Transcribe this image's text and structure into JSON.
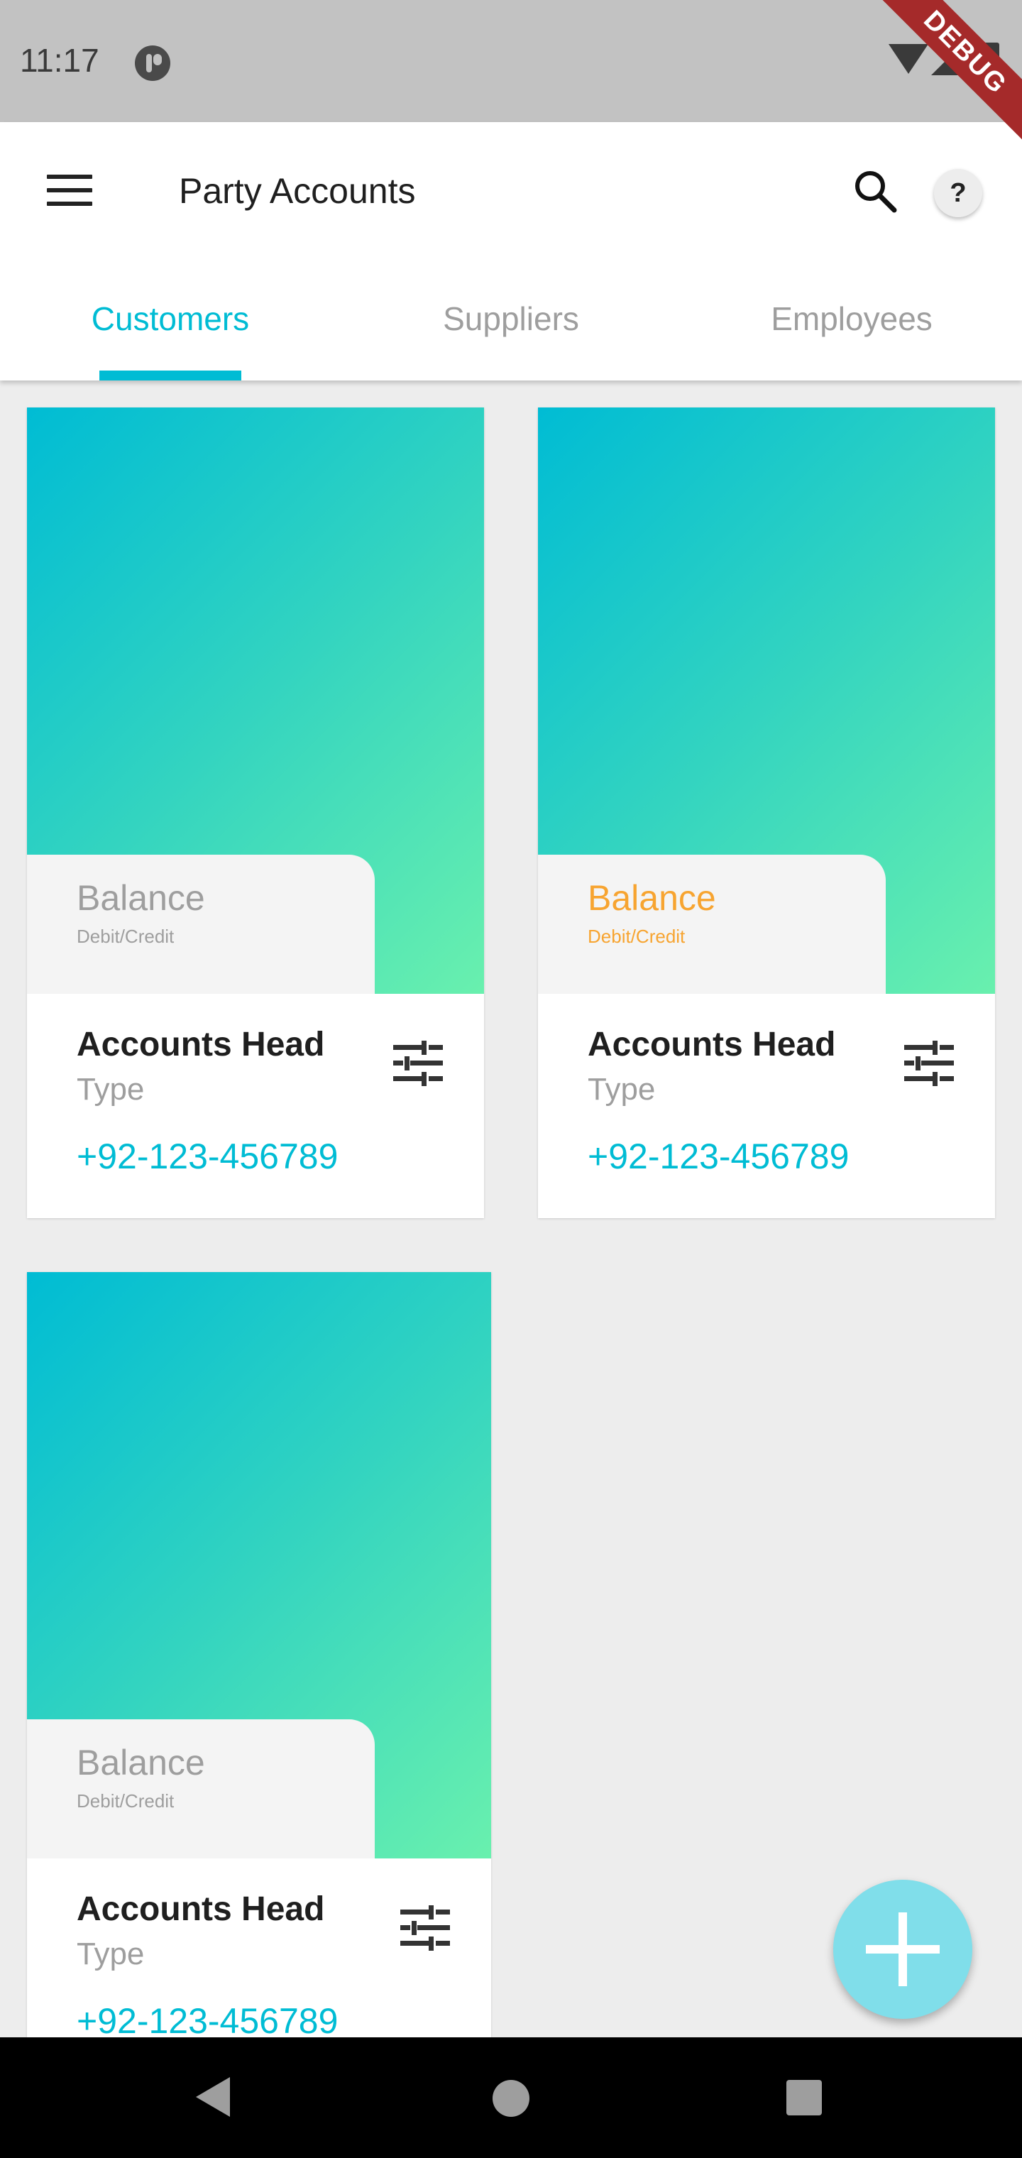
{
  "status_bar": {
    "time": "11:17",
    "debug_banner": "DEBUG"
  },
  "app_bar": {
    "title": "Party Accounts",
    "menu_icon": "hamburger-menu-icon",
    "search_icon": "search-icon",
    "help_label": "?"
  },
  "tabs": [
    {
      "label": "Customers",
      "active": true
    },
    {
      "label": "Suppliers",
      "active": false
    },
    {
      "label": "Employees",
      "active": false
    }
  ],
  "cards": [
    {
      "balance_label": "Balance",
      "balance_sub": "Debit/Credit",
      "balance_color": "#9e9e9e",
      "head": "Accounts Head",
      "type": "Type",
      "phone": "+92-123-456789",
      "action_icon": "tune-icon"
    },
    {
      "balance_label": "Balance",
      "balance_sub": "Debit/Credit",
      "balance_color": "#f7a430",
      "head": "Accounts Head",
      "type": "Type",
      "phone": "+92-123-456789",
      "action_icon": "tune-icon"
    },
    {
      "balance_label": "Balance",
      "balance_sub": "Debit/Credit",
      "balance_color": "#9e9e9e",
      "head": "Accounts Head",
      "type": "Type",
      "phone": "+92-123-456789",
      "action_icon": "tune-icon"
    }
  ],
  "fab": {
    "icon": "add-icon"
  },
  "nav_bar": {
    "back_icon": "back-icon",
    "home_icon": "home-icon",
    "recents_icon": "recents-icon"
  },
  "colors": {
    "accent": "#00bcd4",
    "gradient_start": "#00bcd4",
    "gradient_end": "#69f0ae",
    "balance_orange": "#f7a430",
    "fab": "#80deea",
    "background": "#ededed"
  }
}
